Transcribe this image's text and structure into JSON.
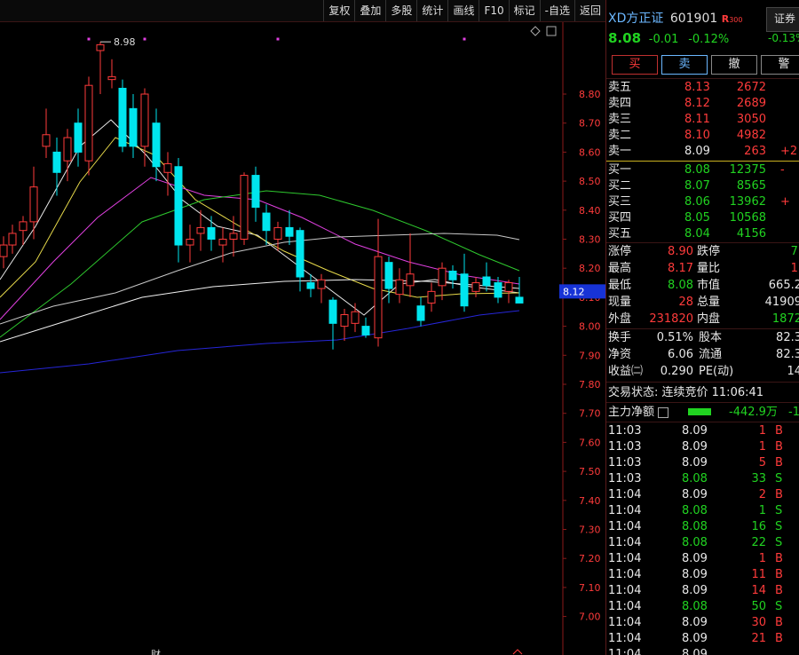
{
  "toolbar": {
    "items": [
      "复权",
      "叠加",
      "多股",
      "统计",
      "画线",
      "F10",
      "标记",
      "-自选",
      "返回"
    ]
  },
  "chart": {
    "price_axis_labels": [
      "8.80",
      "8.70",
      "8.60",
      "8.50",
      "8.40",
      "8.30",
      "8.20",
      "8.10",
      "8.00",
      "7.90",
      "7.80",
      "7.70",
      "7.60",
      "7.50",
      "7.40",
      "7.30",
      "7.20",
      "7.10",
      "7.00"
    ],
    "high_marker": "8.98",
    "current_price_tag": "8.12",
    "bottom_marker": "财"
  },
  "stock": {
    "name": "XD方正证",
    "code": "601901",
    "badge": "R",
    "badge_sub": "300",
    "tab": "证券",
    "price": "8.08",
    "change": "-0.01",
    "change_pct": "-0.12%",
    "side_pct": "-0.13%"
  },
  "trade_buttons": {
    "buy": "买",
    "sell": "卖",
    "cancel": "撤",
    "alert": "警"
  },
  "order_book": {
    "asks": [
      {
        "label": "卖五",
        "price": "8.13",
        "vol": "2672",
        "delta": ""
      },
      {
        "label": "卖四",
        "price": "8.12",
        "vol": "2689",
        "delta": ""
      },
      {
        "label": "卖三",
        "price": "8.11",
        "vol": "3050",
        "delta": ""
      },
      {
        "label": "卖二",
        "price": "8.10",
        "vol": "4982",
        "delta": ""
      },
      {
        "label": "卖一",
        "price": "8.09",
        "vol": "263",
        "delta": "+2"
      }
    ],
    "bids": [
      {
        "label": "买一",
        "price": "8.08",
        "vol": "12375",
        "delta": "-"
      },
      {
        "label": "买二",
        "price": "8.07",
        "vol": "8565",
        "delta": ""
      },
      {
        "label": "买三",
        "price": "8.06",
        "vol": "13962",
        "delta": "+"
      },
      {
        "label": "买四",
        "price": "8.05",
        "vol": "10568",
        "delta": ""
      },
      {
        "label": "买五",
        "price": "8.04",
        "vol": "4156",
        "delta": ""
      }
    ]
  },
  "stats": [
    {
      "l1": "涨停",
      "v1": "8.90",
      "c1": "red",
      "l2": "跌停",
      "v2": "7.",
      "c2": "green"
    },
    {
      "l1": "最高",
      "v1": "8.17",
      "c1": "red",
      "l2": "量比",
      "v2": "1.",
      "c2": "red"
    },
    {
      "l1": "最低",
      "v1": "8.08",
      "c1": "green",
      "l2": "市值",
      "v2": "665.2",
      "c2": "white"
    },
    {
      "l1": "现量",
      "v1": "28",
      "c1": "red",
      "l2": "总量",
      "v2": "41909",
      "c2": "white"
    },
    {
      "l1": "外盘",
      "v1": "231820",
      "c1": "red",
      "l2": "内盘",
      "v2": "1872",
      "c2": "green"
    }
  ],
  "fundamentals": [
    {
      "l1": "换手",
      "v1": "0.51%",
      "l2": "股本",
      "v2": "82.3"
    },
    {
      "l1": "净资",
      "v1": "6.06",
      "l2": "流通",
      "v2": "82.3"
    },
    {
      "l1": "收益㈡",
      "v1": "0.290",
      "l2": "PE(动)",
      "v2": "14"
    }
  ],
  "trade_status": "交易状态: 连续竞价 11:06:41",
  "main_flow": {
    "label": "主力净额",
    "value": "-442.9万",
    "extra": "-1"
  },
  "ticks": [
    {
      "t": "11:03",
      "p": "8.09",
      "v": "1",
      "s": "B"
    },
    {
      "t": "11:03",
      "p": "8.09",
      "v": "1",
      "s": "B"
    },
    {
      "t": "11:03",
      "p": "8.09",
      "v": "5",
      "s": "B"
    },
    {
      "t": "11:03",
      "p": "8.08",
      "v": "33",
      "s": "S"
    },
    {
      "t": "11:04",
      "p": "8.09",
      "v": "2",
      "s": "B"
    },
    {
      "t": "11:04",
      "p": "8.08",
      "v": "1",
      "s": "S"
    },
    {
      "t": "11:04",
      "p": "8.08",
      "v": "16",
      "s": "S"
    },
    {
      "t": "11:04",
      "p": "8.08",
      "v": "22",
      "s": "S"
    },
    {
      "t": "11:04",
      "p": "8.09",
      "v": "1",
      "s": "B"
    },
    {
      "t": "11:04",
      "p": "8.09",
      "v": "11",
      "s": "B"
    },
    {
      "t": "11:04",
      "p": "8.09",
      "v": "14",
      "s": "B"
    },
    {
      "t": "11:04",
      "p": "8.08",
      "v": "50",
      "s": "S"
    },
    {
      "t": "11:04",
      "p": "8.09",
      "v": "30",
      "s": "B"
    },
    {
      "t": "11:04",
      "p": "8.09",
      "v": "21",
      "s": "B"
    },
    {
      "t": "11:04",
      "p": "8.09",
      "v": "",
      "s": ""
    }
  ],
  "colors": {
    "up": "#ff3b3b",
    "down": "#00e5ee",
    "green": "#21d321",
    "axis": "#ff3b3b"
  }
}
